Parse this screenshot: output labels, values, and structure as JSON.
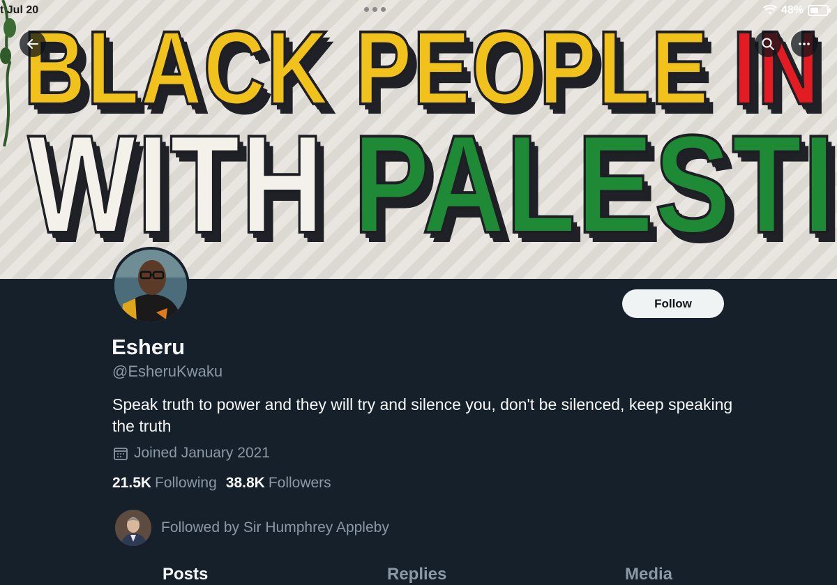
{
  "status_bar": {
    "time": "t Jul 20",
    "battery": "48%"
  },
  "banner": {
    "line1_word1": "BLACK PEOPLE",
    "line1_word2": "IN SOLIDARITY",
    "line2_word1": "WITH",
    "line2_word2": "PALESTINE",
    "colors": {
      "yellow": "#f0c21b",
      "red": "#e31b23",
      "green": "#1f8a36",
      "white": "#f4f1ea"
    }
  },
  "header": {
    "back_icon": "arrow-left-icon",
    "search_icon": "search-icon",
    "more_icon": "more-horizontal-icon"
  },
  "profile": {
    "follow_label": "Follow",
    "name": "Esheru",
    "handle": "@EsheruKwaku",
    "bio": "Speak truth to power and they will try and silence you, don't be silenced, keep speaking the truth",
    "joined": "Joined January 2021",
    "following_count": "21.5K",
    "following_label": "Following",
    "followers_count": "38.8K",
    "followers_label": "Followers",
    "followed_by": "Followed by Sir Humphrey Appleby"
  },
  "tabs": [
    {
      "label": "Posts",
      "active": true
    },
    {
      "label": "Replies",
      "active": false
    },
    {
      "label": "Media",
      "active": false
    }
  ],
  "theme": {
    "background": "#15202b",
    "text_primary": "#f7f9f9",
    "text_secondary": "#8b98a5"
  }
}
